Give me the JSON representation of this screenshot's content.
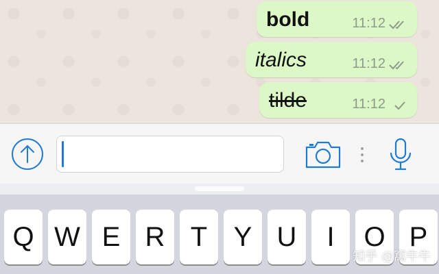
{
  "messages": [
    {
      "text": "bold",
      "time": "11:12",
      "status": "read-double-check-icon"
    },
    {
      "text": "italics",
      "time": "11:12",
      "status": "read-double-check-icon"
    },
    {
      "text": "tilde",
      "time": "11:12",
      "status": "sent-single-check-icon"
    }
  ],
  "input_bar": {
    "message_value": "",
    "icons": [
      "upload-arrow-icon",
      "camera-icon",
      "more-dots-icon",
      "microphone-icon"
    ],
    "accent_color": "#1f7ad1"
  },
  "keyboard": {
    "row1": [
      "Q",
      "W",
      "E",
      "R",
      "T",
      "Y",
      "U",
      "I",
      "O",
      "P"
    ]
  },
  "watermark": "知乎 @窩牛牛",
  "colors": {
    "outgoing_bubble": "#dcf8c6",
    "chat_background": "#ece5dd",
    "tick_color": "#8e9a8b"
  }
}
